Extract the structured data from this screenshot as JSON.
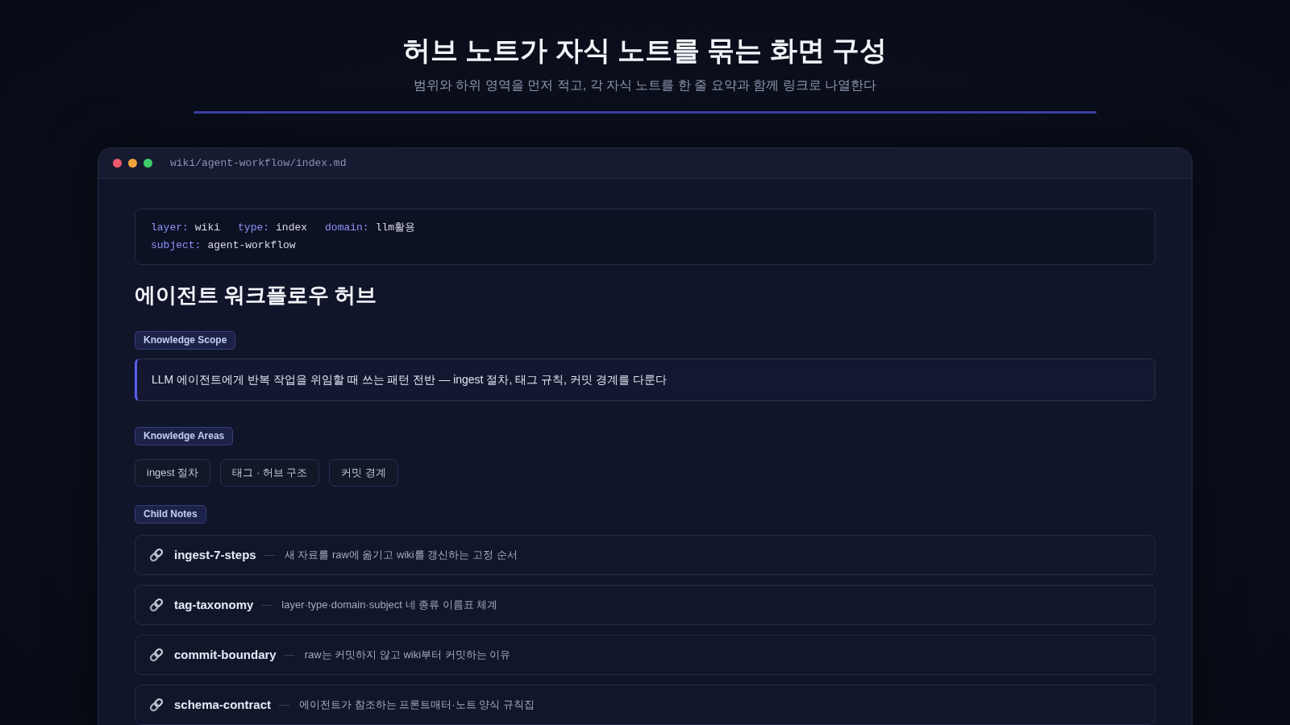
{
  "header": {
    "title": "허브 노트가 자식 노트를 묶는 화면 구성",
    "subtitle": "범위와 하위 영역을 먼저 적고, 각 자식 노트를 한 줄 요약과 함께 링크로 나열한다"
  },
  "window": {
    "path": "wiki/agent-workflow/index.md",
    "frontmatter": [
      [
        {
          "key": "layer:",
          "value": "wiki"
        },
        {
          "key": "type:",
          "value": "index"
        },
        {
          "key": "domain:",
          "value": "llm활용"
        }
      ],
      [
        {
          "key": "subject:",
          "value": "agent-workflow"
        }
      ]
    ],
    "heading": "에이전트 워크플로우 허브",
    "sections": [
      {
        "kind": "scope",
        "label": "Knowledge Scope",
        "text": "LLM 에이전트에게 반복 작업을 위임할 때 쓰는 패턴 전반 — ingest 절차, 태그 규칙, 커밋 경계를 다룬다"
      },
      {
        "kind": "areas",
        "label": "Knowledge Areas",
        "chips": [
          "ingest 절차",
          "태그 · 허브 구조",
          "커밋 경계"
        ]
      },
      {
        "kind": "notes",
        "label": "Child Notes",
        "notes": [
          {
            "name": "ingest-7-steps",
            "separator": "—",
            "summary": "새 자료를 raw에 옮기고 wiki를 갱신하는 고정 순서"
          },
          {
            "name": "tag-taxonomy",
            "separator": "—",
            "summary": "layer·type·domain·subject 네 종류 이름표 체계"
          },
          {
            "name": "commit-boundary",
            "separator": "—",
            "summary": "raw는 커밋하지 않고 wiki부터 커밋하는 이유"
          },
          {
            "name": "schema-contract",
            "separator": "—",
            "summary": "에이전트가 참조하는 프론트매터·노트 양식 규칙집"
          }
        ]
      }
    ]
  }
}
